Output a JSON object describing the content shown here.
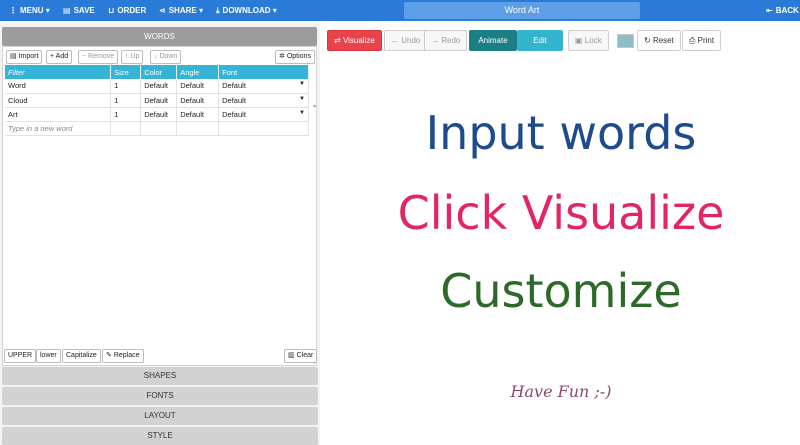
{
  "topbar": {
    "menu": "MENU",
    "save": "SAVE",
    "order": "ORDER",
    "share": "SHARE",
    "download": "DOWNLOAD",
    "title": "Word Art",
    "back": "BACK"
  },
  "words_panel": {
    "title": "WORDS",
    "buttons": {
      "import": "Import",
      "add": "Add",
      "remove": "Remove",
      "up": "Up",
      "down": "Down",
      "options": "Options"
    },
    "columns": [
      "Filter",
      "Size",
      "Color",
      "Angle",
      "Font"
    ],
    "rows": [
      {
        "word": "Word",
        "size": "1",
        "color": "Default",
        "angle": "Default",
        "font": "Default"
      },
      {
        "word": "Cloud",
        "size": "1",
        "color": "Default",
        "angle": "Default",
        "font": "Default"
      },
      {
        "word": "Art",
        "size": "1",
        "color": "Default",
        "angle": "Default",
        "font": "Default"
      }
    ],
    "new_word_placeholder": "Type in a new word",
    "case_buttons": {
      "upper": "UPPER",
      "lower": "lower",
      "capitalize": "Capitalize",
      "replace": "Replace",
      "clear": "Clear"
    }
  },
  "sections": [
    "SHAPES",
    "FONTS",
    "LAYOUT",
    "STYLE"
  ],
  "toolbar": {
    "visualize": "Visualize",
    "undo": "Undo",
    "redo": "Redo",
    "animate": "Animate",
    "edit": "Edit",
    "lock": "Lock",
    "reset": "Reset",
    "print": "Print",
    "swatch_color": "#8fbdc4"
  },
  "canvas": {
    "line1": "Input words",
    "line2": "Click Visualize",
    "line3": "Customize",
    "footer": "Have Fun ;-)"
  },
  "colors": {
    "topbar": "#2a7bd8",
    "table_header": "#36b4d8",
    "visualize_button": "#e8434d",
    "animate_button": "#1c7f86",
    "edit_button": "#33b3cc",
    "line1": "#1e4b8c",
    "line2": "#e22566",
    "line3": "#2d6a2a",
    "footer": "#8a4a6d"
  }
}
